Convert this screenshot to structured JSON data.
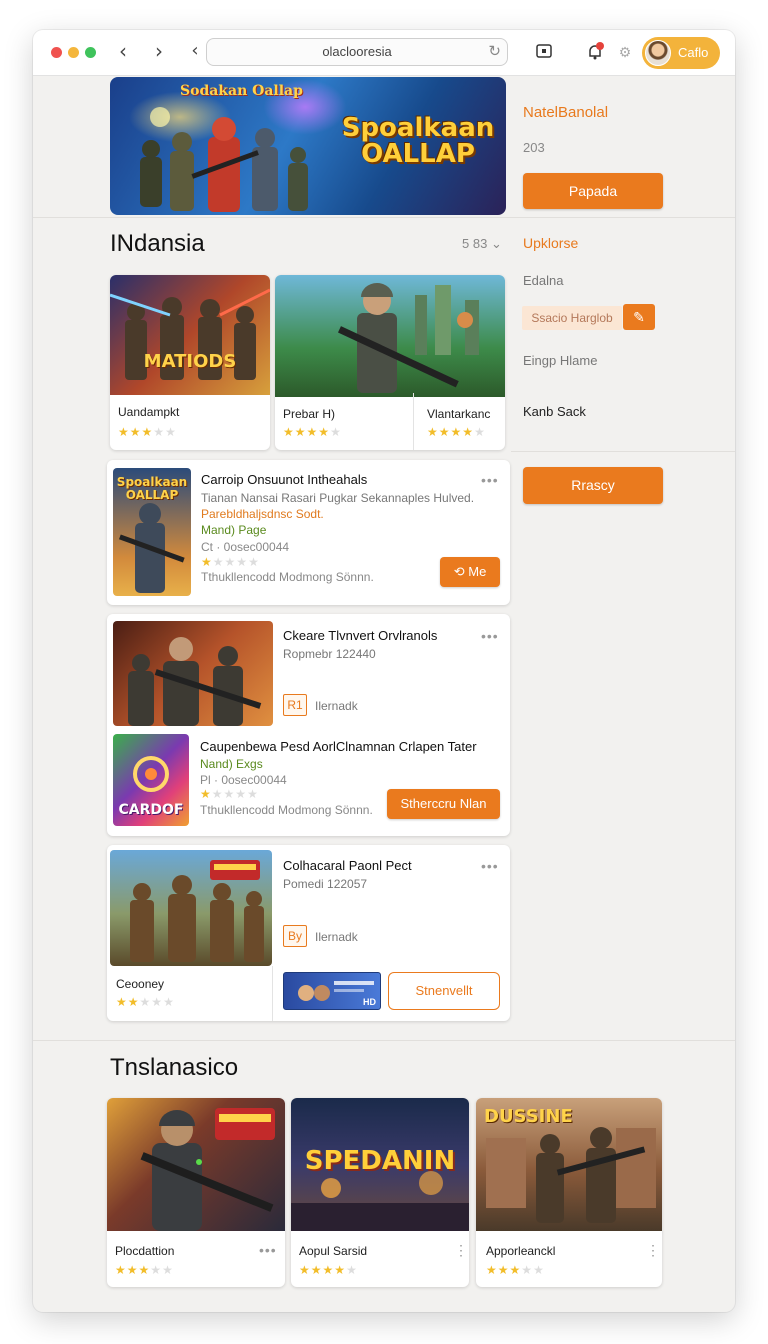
{
  "browser": {
    "url": "olaclooresia",
    "user_name": "Caflo"
  },
  "hero": {
    "top_text": "Sodakan Oallap",
    "title_line1": "Spoalkaan",
    "title_line2": "OALLAP",
    "side_title": "NatelBanolal",
    "side_sub": "203",
    "button": "Papada"
  },
  "section1": {
    "title": "INdansia",
    "sort_label": "5 83",
    "cards": [
      {
        "name": "Uandampkt",
        "rating": 3,
        "thumb_text": "MATIODS"
      },
      {
        "name": "Prebar H)",
        "rating": 4
      },
      {
        "name": "Vlantarkanc",
        "rating": 4
      }
    ]
  },
  "sidebar": {
    "link": "Upklorse",
    "label1": "Edalna",
    "input_value": "Ssacio Harglob",
    "label2": "Eingp Hlame",
    "label3": "Kanb Sack",
    "button": "Rrascy"
  },
  "list": [
    {
      "thumb_text": "Spoalkaan OALLAP",
      "title": "Carroip Onsuunot Intheahals",
      "desc": "Tianan Nansai Rasari Pugkar Sekannaples Hulved.",
      "tag": "Parebldhaljsdnsc Sodt.",
      "tag2": "Mand) Page",
      "code": "Ct · 0osec00044",
      "footer": "Tthukllencodd Modmong Sönnn.",
      "rating": 1,
      "button": "Me"
    },
    {
      "title": "Ckeare Tlvnvert Orvlranols",
      "sub": "Ropmebr 122440",
      "badge": "R1",
      "badge_label": "Ilernadk",
      "title2": "Caupenbewa Pesd AorlClnamnan Crlapen Tater",
      "tag2": "Nand) Exgs",
      "code": "Pl · 0osec00044",
      "footer": "Tthukllencodd Modmong Sönnn.",
      "rating": 1,
      "thumb2_text": "CARDOF",
      "button": "Stherccru Nlan"
    },
    {
      "title": "Colhacaral Paonl Pect",
      "sub": "Pomedi 122057",
      "badge": "By",
      "badge_label": "Ilernadk",
      "name": "Ceooney",
      "rating": 2,
      "mini_text": "HD",
      "button": "Stnenvellt"
    }
  ],
  "section2": {
    "title": "Tnslanasico",
    "cards": [
      {
        "name": "Plocdattion",
        "rating": 3
      },
      {
        "name": "Aopul Sarsid",
        "rating": 4,
        "thumb_text": "SPEDANIN"
      },
      {
        "name": "Apporleanckl",
        "rating": 3,
        "thumb_text": "DUSSINE"
      }
    ]
  },
  "colors": {
    "accent": "#ea7a1e",
    "star": "#f2bd2a",
    "profile": "#f3b33b"
  }
}
